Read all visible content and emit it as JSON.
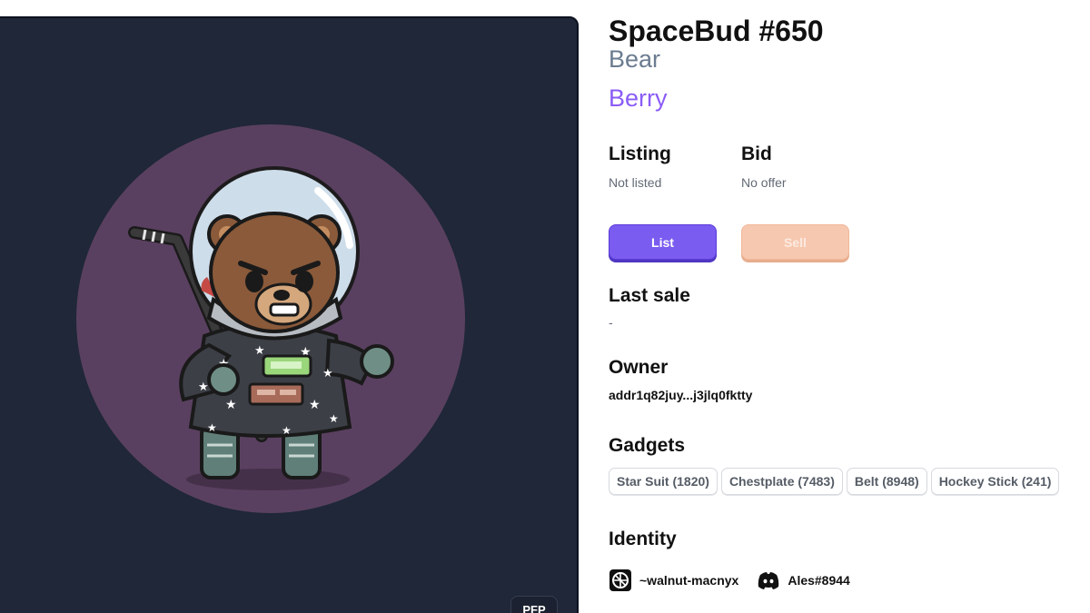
{
  "nft": {
    "title": "SpaceBud #650",
    "species": "Bear",
    "type": "Berry",
    "badge_label": "PFP"
  },
  "market": {
    "listing_heading": "Listing",
    "listing_value": "Not listed",
    "bid_heading": "Bid",
    "bid_value": "No offer",
    "list_label": "List",
    "sell_label": "Sell"
  },
  "last_sale": {
    "heading": "Last sale",
    "value": "-"
  },
  "owner": {
    "heading": "Owner",
    "address": "addr1q82juy...j3jlq0fktty"
  },
  "gadgets": {
    "heading": "Gadgets",
    "items": [
      "Star Suit (1820)",
      "Chestplate (7483)",
      "Belt (8948)",
      "Hockey Stick (241)"
    ]
  },
  "identity": {
    "heading": "Identity",
    "handle_icon": "handle-logo-icon",
    "handle": "~walnut-macnyx",
    "discord_icon": "discord-icon",
    "discord": "Ales#8944"
  },
  "colors": {
    "panel_bg": "#1f2738",
    "circle_bg": "#5a4060",
    "accent_purple": "#8b5cf6",
    "list_button": "#7b5cf0",
    "sell_button": "#f7c8b0"
  }
}
